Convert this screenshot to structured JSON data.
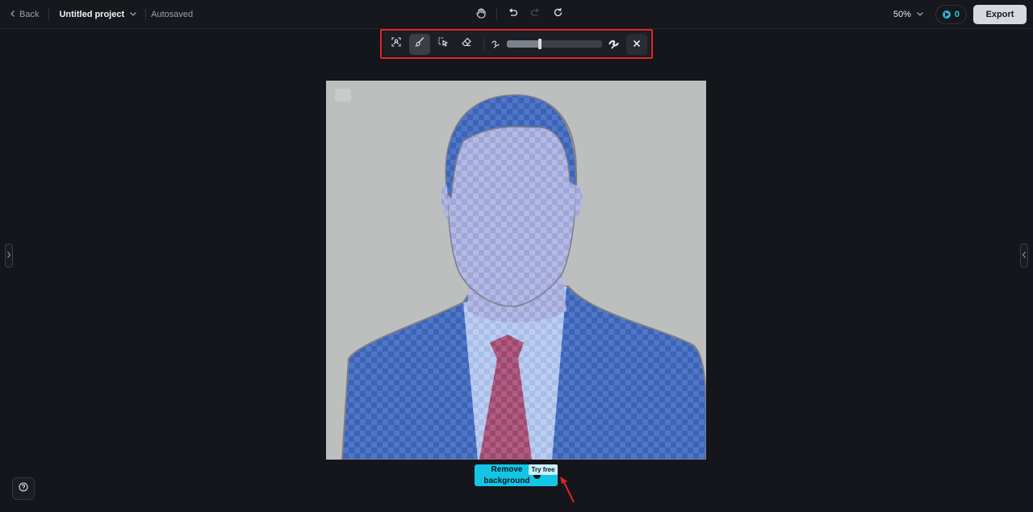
{
  "header": {
    "back_label": "Back",
    "project_title": "Untitled project",
    "autosave_status": "Autosaved",
    "zoom_level": "50%",
    "credits_count": "0",
    "export_label": "Export"
  },
  "toolbar": {
    "active_tool": "brush",
    "tools": [
      "auto-select-icon",
      "brush-icon",
      "lasso-select-icon",
      "eraser-icon"
    ],
    "brush_size_fraction": 0.35
  },
  "canvas": {
    "remove_background_label": "Remove background",
    "try_free_label": "Try free"
  },
  "colors": {
    "accent": "#14c6e6",
    "highlight_box": "#e0262a",
    "mask_overlay": "#2f5bb5"
  }
}
